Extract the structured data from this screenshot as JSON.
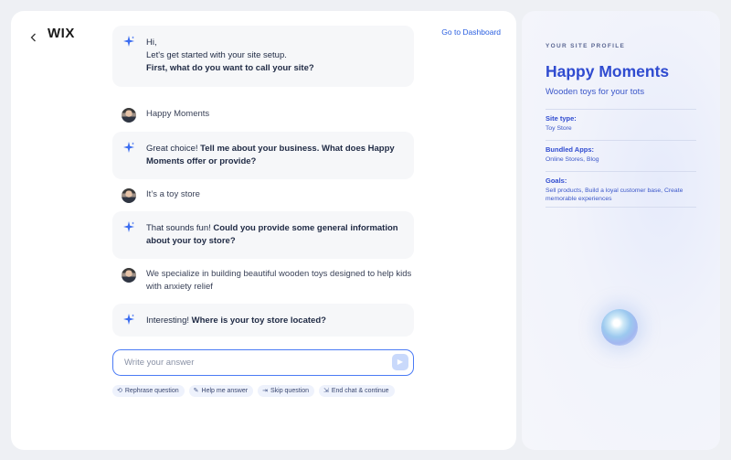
{
  "header": {
    "logo": "WIX",
    "back_icon": "chevron-left-icon",
    "dashboard_link": "Go to Dashboard"
  },
  "chat": {
    "messages": [
      {
        "role": "assistant",
        "lines": [
          "Hi,",
          "Let's get started with your site setup."
        ],
        "bold": "First, what do you want to call your site?"
      },
      {
        "role": "user",
        "text": "Happy Moments"
      },
      {
        "role": "assistant",
        "plain": "Great choice! ",
        "bold": "Tell me about your business. What does Happy Moments offer or provide?"
      },
      {
        "role": "user",
        "text": "It’s a toy store"
      },
      {
        "role": "assistant",
        "plain": "That sounds fun! ",
        "bold": "Could you provide some general information about your toy store?"
      },
      {
        "role": "user",
        "text": "We specialize in building beautiful wooden toys designed to help kids with anxiety relief"
      },
      {
        "role": "assistant",
        "plain": "Interesting! ",
        "bold": "Where is your toy store located?"
      }
    ]
  },
  "input": {
    "placeholder": "Write your answer",
    "value": ""
  },
  "chips": [
    {
      "label": "Rephrase question",
      "icon": "refresh-icon"
    },
    {
      "label": "Help me answer",
      "icon": "wand-icon"
    },
    {
      "label": "Skip question",
      "icon": "skip-icon"
    },
    {
      "label": "End chat & continue",
      "icon": "exit-icon"
    }
  ],
  "profile": {
    "kicker": "YOUR SITE PROFILE",
    "title": "Happy Moments",
    "subtitle": "Wooden toys for your tots",
    "fields": [
      {
        "label": "Site type:",
        "value": "Toy Store"
      },
      {
        "label": "Bundled Apps:",
        "value": "Online Stores, Blog"
      },
      {
        "label": "Goals:",
        "value": "Sell products, Build a loyal customer base, Create memorable experiences"
      }
    ]
  },
  "colors": {
    "accent": "#2f4bd0",
    "link": "#2a5fe0",
    "input_border": "#4b7bf5"
  }
}
